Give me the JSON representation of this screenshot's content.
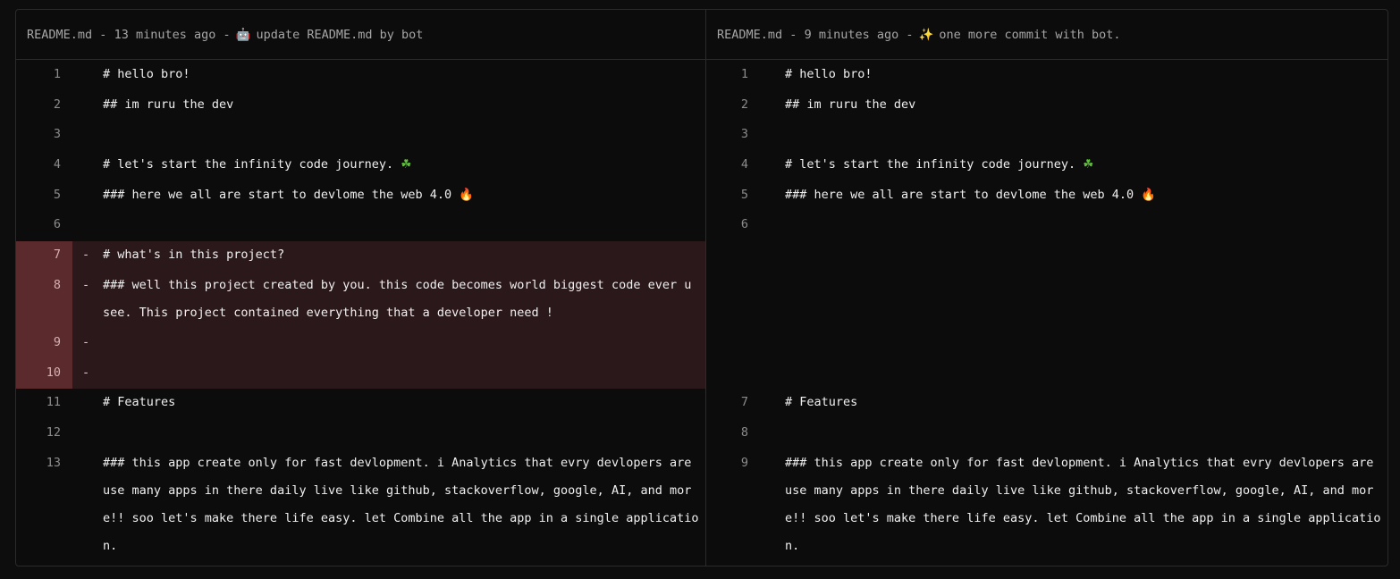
{
  "left": {
    "file": "README.md",
    "sep1": "-",
    "time": "13 minutes ago",
    "sep2": "-",
    "emoji": "🤖",
    "message": "update README.md by bot",
    "lines": [
      {
        "n": "1",
        "sign": "",
        "text": "# hello bro!"
      },
      {
        "n": "2",
        "sign": "",
        "text": "## im ruru the dev"
      },
      {
        "n": "3",
        "sign": "",
        "text": ""
      },
      {
        "n": "4",
        "sign": "",
        "text": "# let's start the infinity code journey.",
        "emoji": "☘"
      },
      {
        "n": "5",
        "sign": "",
        "text": "### here we all are start to devlome the web 4.0",
        "emoji": "🔥"
      },
      {
        "n": "6",
        "sign": "",
        "text": ""
      },
      {
        "n": "7",
        "sign": "-",
        "text": "# what's in this project?"
      },
      {
        "n": "8",
        "sign": "-",
        "text": "### well this project created by you. this code becomes world biggest code ever u see. This project contained everything that a developer need !"
      },
      {
        "n": "9",
        "sign": "-",
        "text": ""
      },
      {
        "n": "10",
        "sign": "-",
        "text": ""
      },
      {
        "n": "11",
        "sign": "",
        "text": "# Features"
      },
      {
        "n": "12",
        "sign": "",
        "text": ""
      },
      {
        "n": "13",
        "sign": "",
        "text": "### this app create only for fast devlopment. i Analytics that evry devlopers are use many apps in there daily live like github, stackoverflow, google, AI, and more!! soo let's make there life easy. let Combine all the app in a single application."
      }
    ]
  },
  "right": {
    "file": "README.md",
    "sep1": "-",
    "time": "9 minutes ago",
    "sep2": "-",
    "emoji": "✨",
    "message": "one more commit with bot.",
    "lines": [
      {
        "n": "1",
        "text": "# hello bro!"
      },
      {
        "n": "2",
        "text": "## im ruru the dev"
      },
      {
        "n": "3",
        "text": ""
      },
      {
        "n": "4",
        "text": "# let's start the infinity code journey.",
        "emoji": "☘"
      },
      {
        "n": "5",
        "text": "### here we all are start to devlome the web 4.0",
        "emoji": "🔥"
      },
      {
        "n": "6",
        "text": ""
      },
      {
        "n": "7",
        "text": "# Features"
      },
      {
        "n": "8",
        "text": ""
      },
      {
        "n": "9",
        "text": "### this app create only for fast devlopment. i Analytics that evry devlopers are use many apps in there daily live like github, stackoverflow, google, AI, and more!! soo let's make there life easy. let Combine all the app in a single application."
      }
    ]
  },
  "colors": {
    "deleted_bg": "#2b181b",
    "deleted_gutter": "#5a2a2d",
    "border": "#2b2b2b",
    "background": "#0d0d0d"
  }
}
